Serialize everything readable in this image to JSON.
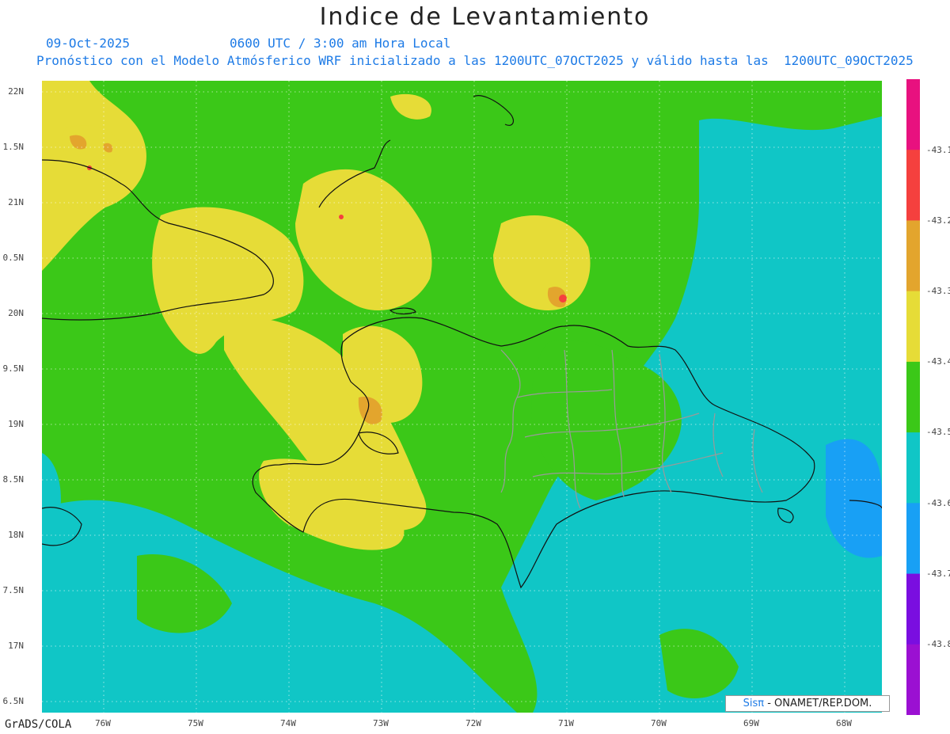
{
  "title": "Indice de Levantamiento",
  "date": "09-Oct-2025",
  "time": "0600 UTC / 3:00 am Hora Local",
  "subtitle": "Pronóstico con el Modelo Atmósferico WRF inicializado a las 1200UTC_07OCT2025 y válido hasta las  1200UTC_09OCT2025",
  "lat_labels": [
    "22N",
    "1.5N",
    "21N",
    "0.5N",
    "20N",
    "9.5N",
    "19N",
    "8.5N",
    "18N",
    "7.5N",
    "17N",
    "6.5N"
  ],
  "lon_labels": [
    "76W",
    "75W",
    "74W",
    "73W",
    "72W",
    "71W",
    "70W",
    "69W",
    "68W"
  ],
  "colorbar": {
    "labels": [
      "-43.1",
      "-43.2",
      "-43.3",
      "-43.4",
      "-43.5",
      "-43.6",
      "-43.7",
      "-43.8"
    ],
    "colors": [
      "#e8117f",
      "#f5403e",
      "#e3a52d",
      "#e6dc37",
      "#3bc818",
      "#10c6c6",
      "#18a0f5",
      "#7a0ee0",
      "#9b10d2"
    ]
  },
  "credit": {
    "brand": "Sisπ",
    "text": "- ONAMET/REP.DOM."
  },
  "footer": "GrADS/COLA"
}
